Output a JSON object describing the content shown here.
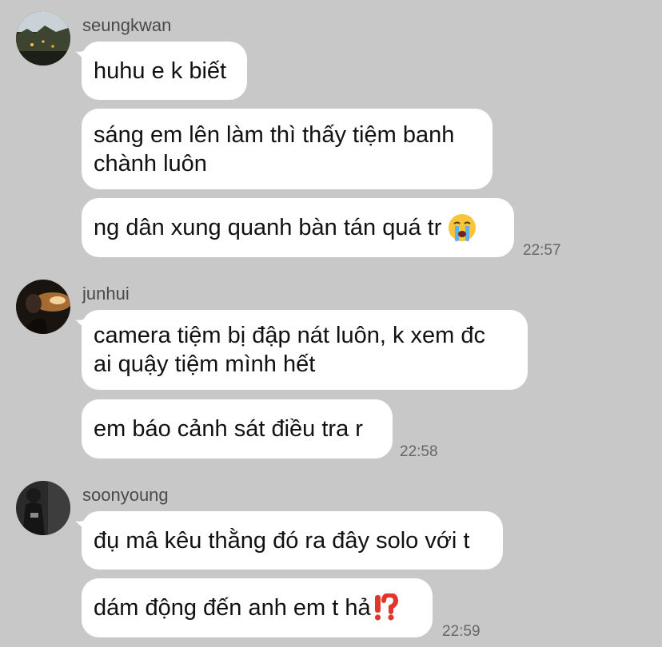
{
  "groups": [
    {
      "sender": "seungkwan",
      "avatar_icon": "avatar-seungkwan",
      "messages": [
        "huhu e k biết",
        "sáng em lên làm thì thấy tiệm banh\nchành luôn",
        "ng dân xung quanh bàn tán quá tr"
      ],
      "last_emoji": "crying-face-emoji",
      "time": "22:57"
    },
    {
      "sender": "junhui",
      "avatar_icon": "avatar-junhui",
      "messages": [
        "camera tiệm bị đập nát luôn, k xem đc\nai quậy tiệm mình hết",
        "em báo cảnh sát điều tra r"
      ],
      "time": "22:58"
    },
    {
      "sender": "soonyoung",
      "avatar_icon": "avatar-soonyoung",
      "messages": [
        "đụ mâ kêu thằng đó ra đây solo với t",
        "dám động đến anh em t hả"
      ],
      "last_emoji": "exclamation-question-emoji",
      "time": "22:59"
    }
  ]
}
